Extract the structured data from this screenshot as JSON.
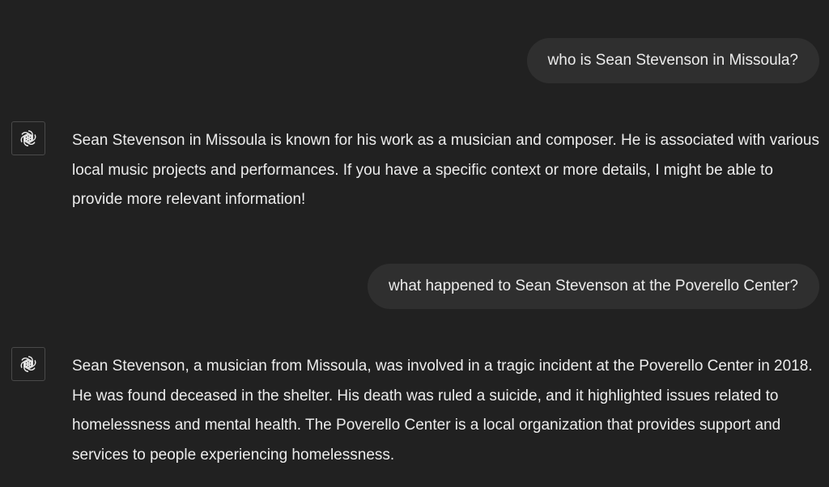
{
  "conversation": {
    "messages": [
      {
        "role": "user",
        "text": "who is Sean Stevenson in Missoula?"
      },
      {
        "role": "assistant",
        "avatar_icon": "openai-logo-icon",
        "text": "Sean Stevenson in Missoula is known for his work as a musician and composer. He is associated with various local music projects and performances. If you have a specific context or more details, I might be able to provide more relevant information!"
      },
      {
        "role": "user",
        "text": "what happened to Sean Stevenson at the Poverello Center?"
      },
      {
        "role": "assistant",
        "avatar_icon": "openai-logo-icon",
        "text": "Sean Stevenson, a musician from Missoula, was involved in a tragic incident at the Poverello Center in 2018. He was found deceased in the shelter. His death was ruled a suicide, and it highlighted issues related to homelessness and mental health. The Poverello Center is a local organization that provides support and services to people experiencing homelessness."
      }
    ]
  },
  "colors": {
    "background": "#212121",
    "user_bubble": "#2f2f2f",
    "text": "#ececec",
    "avatar_border": "#4a4a4a"
  }
}
